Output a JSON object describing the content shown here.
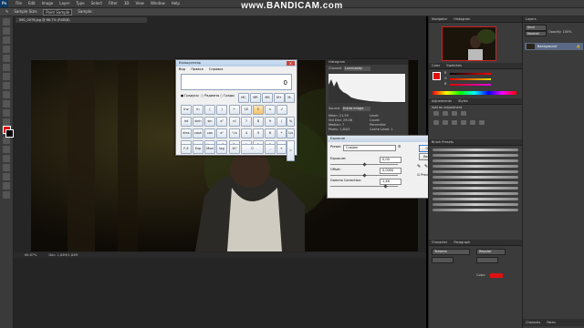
{
  "watermark": {
    "prefix": "www.",
    "brand": "BANDICAM",
    "suffix": ".com"
  },
  "menu": {
    "logo": "Ps",
    "items": [
      "File",
      "Edit",
      "Image",
      "Layer",
      "Type",
      "Select",
      "Filter",
      "3D",
      "View",
      "Window",
      "Help"
    ]
  },
  "options_bar": {
    "sample_size": "Sample Size:",
    "sample_value": "Point Sample",
    "sample": "Sample:"
  },
  "document": {
    "tab_label": "IMG_0076.jpg @ 66.7% (RGB/8)",
    "zoom": "66.67%",
    "doc_size": "Doc: 1,84M/1,84M"
  },
  "colors": {
    "foreground": "#e01010",
    "background": "#000000",
    "layer_highlight": "#5a6a86"
  },
  "calculator": {
    "title": "Калькулятор",
    "menu": [
      "Вид",
      "Правка",
      "Справка"
    ],
    "display": "0",
    "angle_modes": [
      "Градусы",
      "Радианы",
      "Грады"
    ],
    "buttons_row1": [
      "MC",
      "MR",
      "MS",
      "M+",
      "M-"
    ],
    "buttons_row2": [
      "Inv",
      "ln",
      "(",
      ")",
      "←",
      "CE",
      "C",
      "±",
      "√"
    ],
    "buttons_row3": [
      "Int",
      "sinh",
      "sin",
      "x²",
      "n!",
      "7",
      "8",
      "9",
      "/",
      "%"
    ],
    "buttons_row4": [
      "dms",
      "cosh",
      "cos",
      "xʸ",
      "ʸ√x",
      "4",
      "5",
      "6",
      "*",
      "1/x"
    ],
    "buttons_row5": [
      "π",
      "tanh",
      "tan",
      "x³",
      "∛x",
      "1",
      "2",
      "3",
      "-",
      "="
    ],
    "buttons_row6": [
      "F-E",
      "Exp",
      "Mod",
      "log",
      "10ˣ",
      "0",
      ",",
      "+"
    ]
  },
  "histogram": {
    "title": "Histogram",
    "channel_label": "Channel:",
    "channel_value": "Luminosity",
    "source_label": "Source:",
    "source_value": "Entire Image",
    "stats": [
      {
        "label": "Mean:",
        "value": "21.59"
      },
      {
        "label": "Std Dev:",
        "value": "29.06"
      },
      {
        "label": "Median:",
        "value": "7"
      },
      {
        "label": "Pixels:",
        "value": "1,84/5"
      }
    ],
    "stats_right": [
      "Level:",
      "Count:",
      "Percentile:",
      "Cache Level: 1"
    ]
  },
  "exposure": {
    "title": "Exposure",
    "preset_label": "Preset:",
    "preset_value": "Custom",
    "ok": "OK",
    "reset": "Reset",
    "exposure_label": "Exposure:",
    "exposure_value": "0,00",
    "offset_label": "Offset:",
    "offset_value": "0,0000",
    "gamma_label": "Gamma Correction:",
    "gamma_value": "1,46",
    "preview_label": "Preview",
    "preview_checked": true
  },
  "panels": {
    "navigator": "Navigator",
    "histogram_tab": "Histogram",
    "color": "Color",
    "swatches": "Swatches",
    "adjustments": "Adjustments",
    "styles": "Styles",
    "add_adjustment": "Add an adjustment",
    "brush_presets": "Brush Presets",
    "character": "Character",
    "paragraph": "Paragraph",
    "font_family": "Tahoma",
    "font_style": "Regular",
    "color_label": "Color:",
    "channels": "Channels",
    "paths": "Paths",
    "layers": "Layers",
    "kind": "Kind",
    "normal": "Normal",
    "opacity": "Opacity: 100%",
    "layer_name": "Background"
  },
  "color_panel": {
    "r": "R",
    "g": "G",
    "b": "B"
  }
}
